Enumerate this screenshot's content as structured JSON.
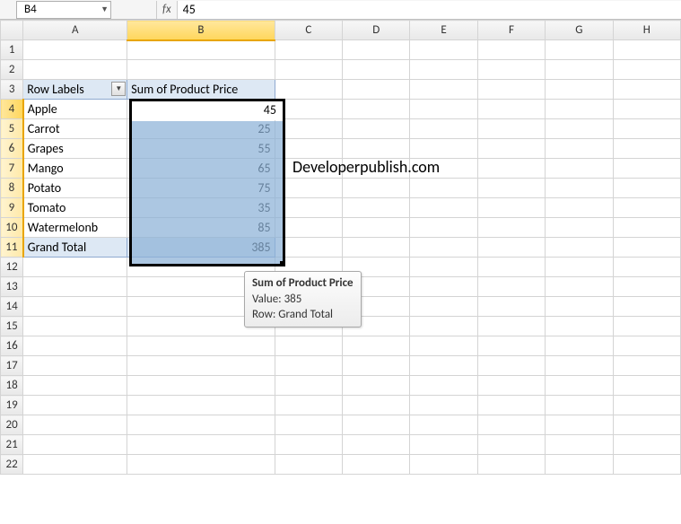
{
  "formula_bar": {
    "name_box": "B4",
    "fx_label": "fx",
    "formula_value": "45"
  },
  "columns": [
    "A",
    "B",
    "C",
    "D",
    "E",
    "F",
    "G",
    "H"
  ],
  "rows": [
    "1",
    "2",
    "3",
    "4",
    "5",
    "6",
    "7",
    "8",
    "9",
    "10",
    "11",
    "12",
    "13",
    "14",
    "15",
    "16",
    "17",
    "18",
    "19",
    "20",
    "21",
    "22"
  ],
  "pivot": {
    "header_a": "Row Labels",
    "header_b": "Sum of Product Price",
    "items": [
      {
        "label": "Apple",
        "value": "45"
      },
      {
        "label": "Carrot",
        "value": "25"
      },
      {
        "label": "Grapes",
        "value": "55"
      },
      {
        "label": "Mango",
        "value": "65"
      },
      {
        "label": "Potato",
        "value": "75"
      },
      {
        "label": "Tomato",
        "value": "35"
      },
      {
        "label": "Watermelonb",
        "value": "85"
      }
    ],
    "total_label": "Grand Total",
    "total_value": "385"
  },
  "tooltip": {
    "title": "Sum of Product Price",
    "line2": "Value: 385",
    "line3": "Row: Grand Total"
  },
  "watermark": "Developerpublish.com"
}
